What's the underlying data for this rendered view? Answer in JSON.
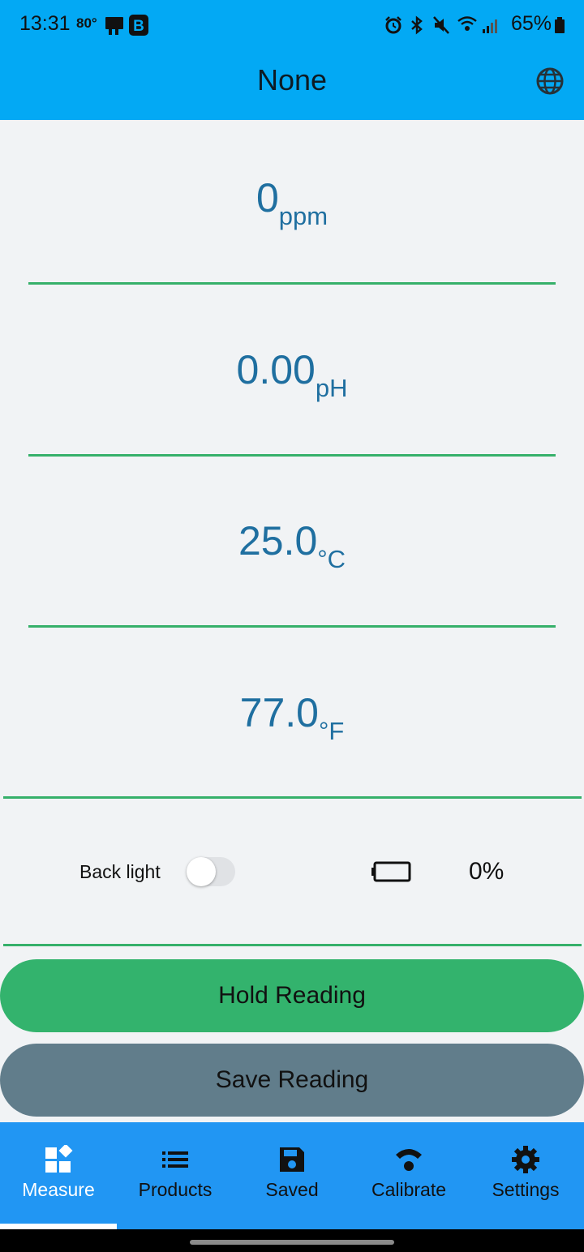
{
  "status_bar": {
    "time": "13:31",
    "temperature": "80°",
    "battery_percent": "65%",
    "icons": [
      "cast-icon",
      "b-app-icon",
      "alarm-icon",
      "bluetooth-icon",
      "mute-icon",
      "wifi-icon",
      "signal-icon",
      "battery-icon"
    ]
  },
  "app_bar": {
    "title": "None",
    "action_icon": "globe-icon"
  },
  "readings": [
    {
      "value": "0",
      "unit": "ppm"
    },
    {
      "value": "0.00",
      "unit": "pH"
    },
    {
      "value": "25.0",
      "unit": "°C"
    },
    {
      "value": "77.0",
      "unit": "°F"
    }
  ],
  "controls": {
    "backlight_label": "Back light",
    "backlight_on": false,
    "battery_level": "0%"
  },
  "buttons": {
    "hold": "Hold Reading",
    "save": "Save Reading"
  },
  "bottom_nav": {
    "items": [
      {
        "label": "Measure",
        "icon": "dashboard-icon",
        "active": true
      },
      {
        "label": "Products",
        "icon": "list-icon",
        "active": false
      },
      {
        "label": "Saved",
        "icon": "save-icon",
        "active": false
      },
      {
        "label": "Calibrate",
        "icon": "wifi-signal-icon",
        "active": false
      },
      {
        "label": "Settings",
        "icon": "gear-icon",
        "active": false
      }
    ]
  },
  "colors": {
    "app_bar": "#03a9f4",
    "reading_text": "#1f6fa0",
    "divider": "#36b06a",
    "hold_button": "#33b36d",
    "save_button": "#617d8b",
    "bottom_nav": "#2196f3"
  }
}
